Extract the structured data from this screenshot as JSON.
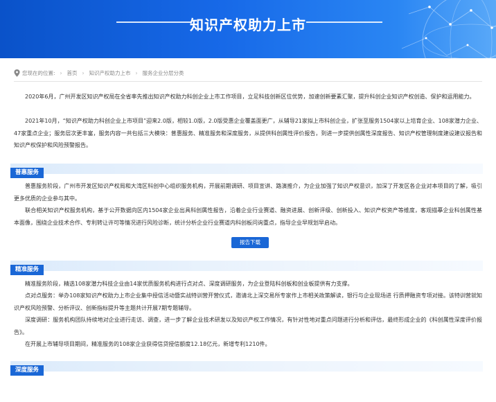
{
  "banner": {
    "title": "知识产权助力上市"
  },
  "breadcrumb": {
    "prefix": "您现在的位置:",
    "items": [
      "首页",
      "知识产权助力上市",
      "服务企业分层分类"
    ]
  },
  "intro": {
    "paragraphs": [
      "2020年6月，广州开发区知识产权局在全省率先推出知识产权助力科创企业上市工作项目，立足科技创新区位优势，加速创新要素汇聚，提升科创企业知识产权创造、保护和运用能力。",
      "2021年10月，“知识产权助力科创企业上市项目”迎来2.0版，相较1.0版，2.0版受惠企业覆盖面更广，从辅导21家拟上市科创企业，扩张至服务1504家以上培育企业、108家潜力企业、47家重点企业；服务层次更丰富，服务内容一共包括三大模块：普惠服务、精准服务和深度服务，从提供科创属性评价报告，到进一步提供创属性深度报告、知识产权管理制度建设建议报告和知识产权保护和风险预警报告。"
    ]
  },
  "sections": {
    "puhui": {
      "title": "普惠服务",
      "paragraphs": [
        "普惠服务阶段，广州市开发区知识产权局和大湾区科创中心组织服务机构，开展前期调研、项目宣讲、路演推介，为企业加强了知识产权意识，加深了开发区各企业对本项目的了解，吸引更多优质的企业参与其中。",
        "联合相关知识产权服务机构，基于公开数据向区内1504家企业出具科创属性报告，沿着企业行业赛道、融资进展、创新评级、创新投入、知识产权资产等维度，客观描摹企业科创属性基本面像，围绕企业技术合作、专利转让许可等情况进行风险诊断，统计分析企业行业赛道内科创板问询重点，指导企业早规划早启动。"
      ],
      "button_label": "报告下载"
    },
    "jingzhun": {
      "title": "精准服务",
      "paragraphs": [
        "精准服务阶段，精选108家潜力科技企业由14家优质服务机构进行点对点、深度调研服务，为企业登陆科创板和创业板提供有力支撑。",
        "点对点服务：举办108家知识产权助力上市企业集中授信活动暨实战特训营开营仪式，邀请北上深交易所专家作上市相关政策解读，银行与企业现场进 行质押融资专项对接。该特训营就知识产权风险预警、分析评议、创新指标提升等主题共计开展7期专题辅导。",
        "深度调研：服务机构团队持续地对企业进行走访、调查，进一步了解企业技术研发以及知识产权工作情况，有针对性地对重点问题进行分析和评估，最终形成企业的《科创属性深度评价报告》。",
        "在开展上市辅导项目期间，精准服务的108家企业获得信贷授信额度12.18亿元，新增专利1210件。"
      ]
    },
    "shendu": {
      "title": "深度服务"
    }
  },
  "colors": {
    "accent": "#1a67d6",
    "banner_start": "#0a52c9",
    "banner_end": "#5aa9f8"
  }
}
